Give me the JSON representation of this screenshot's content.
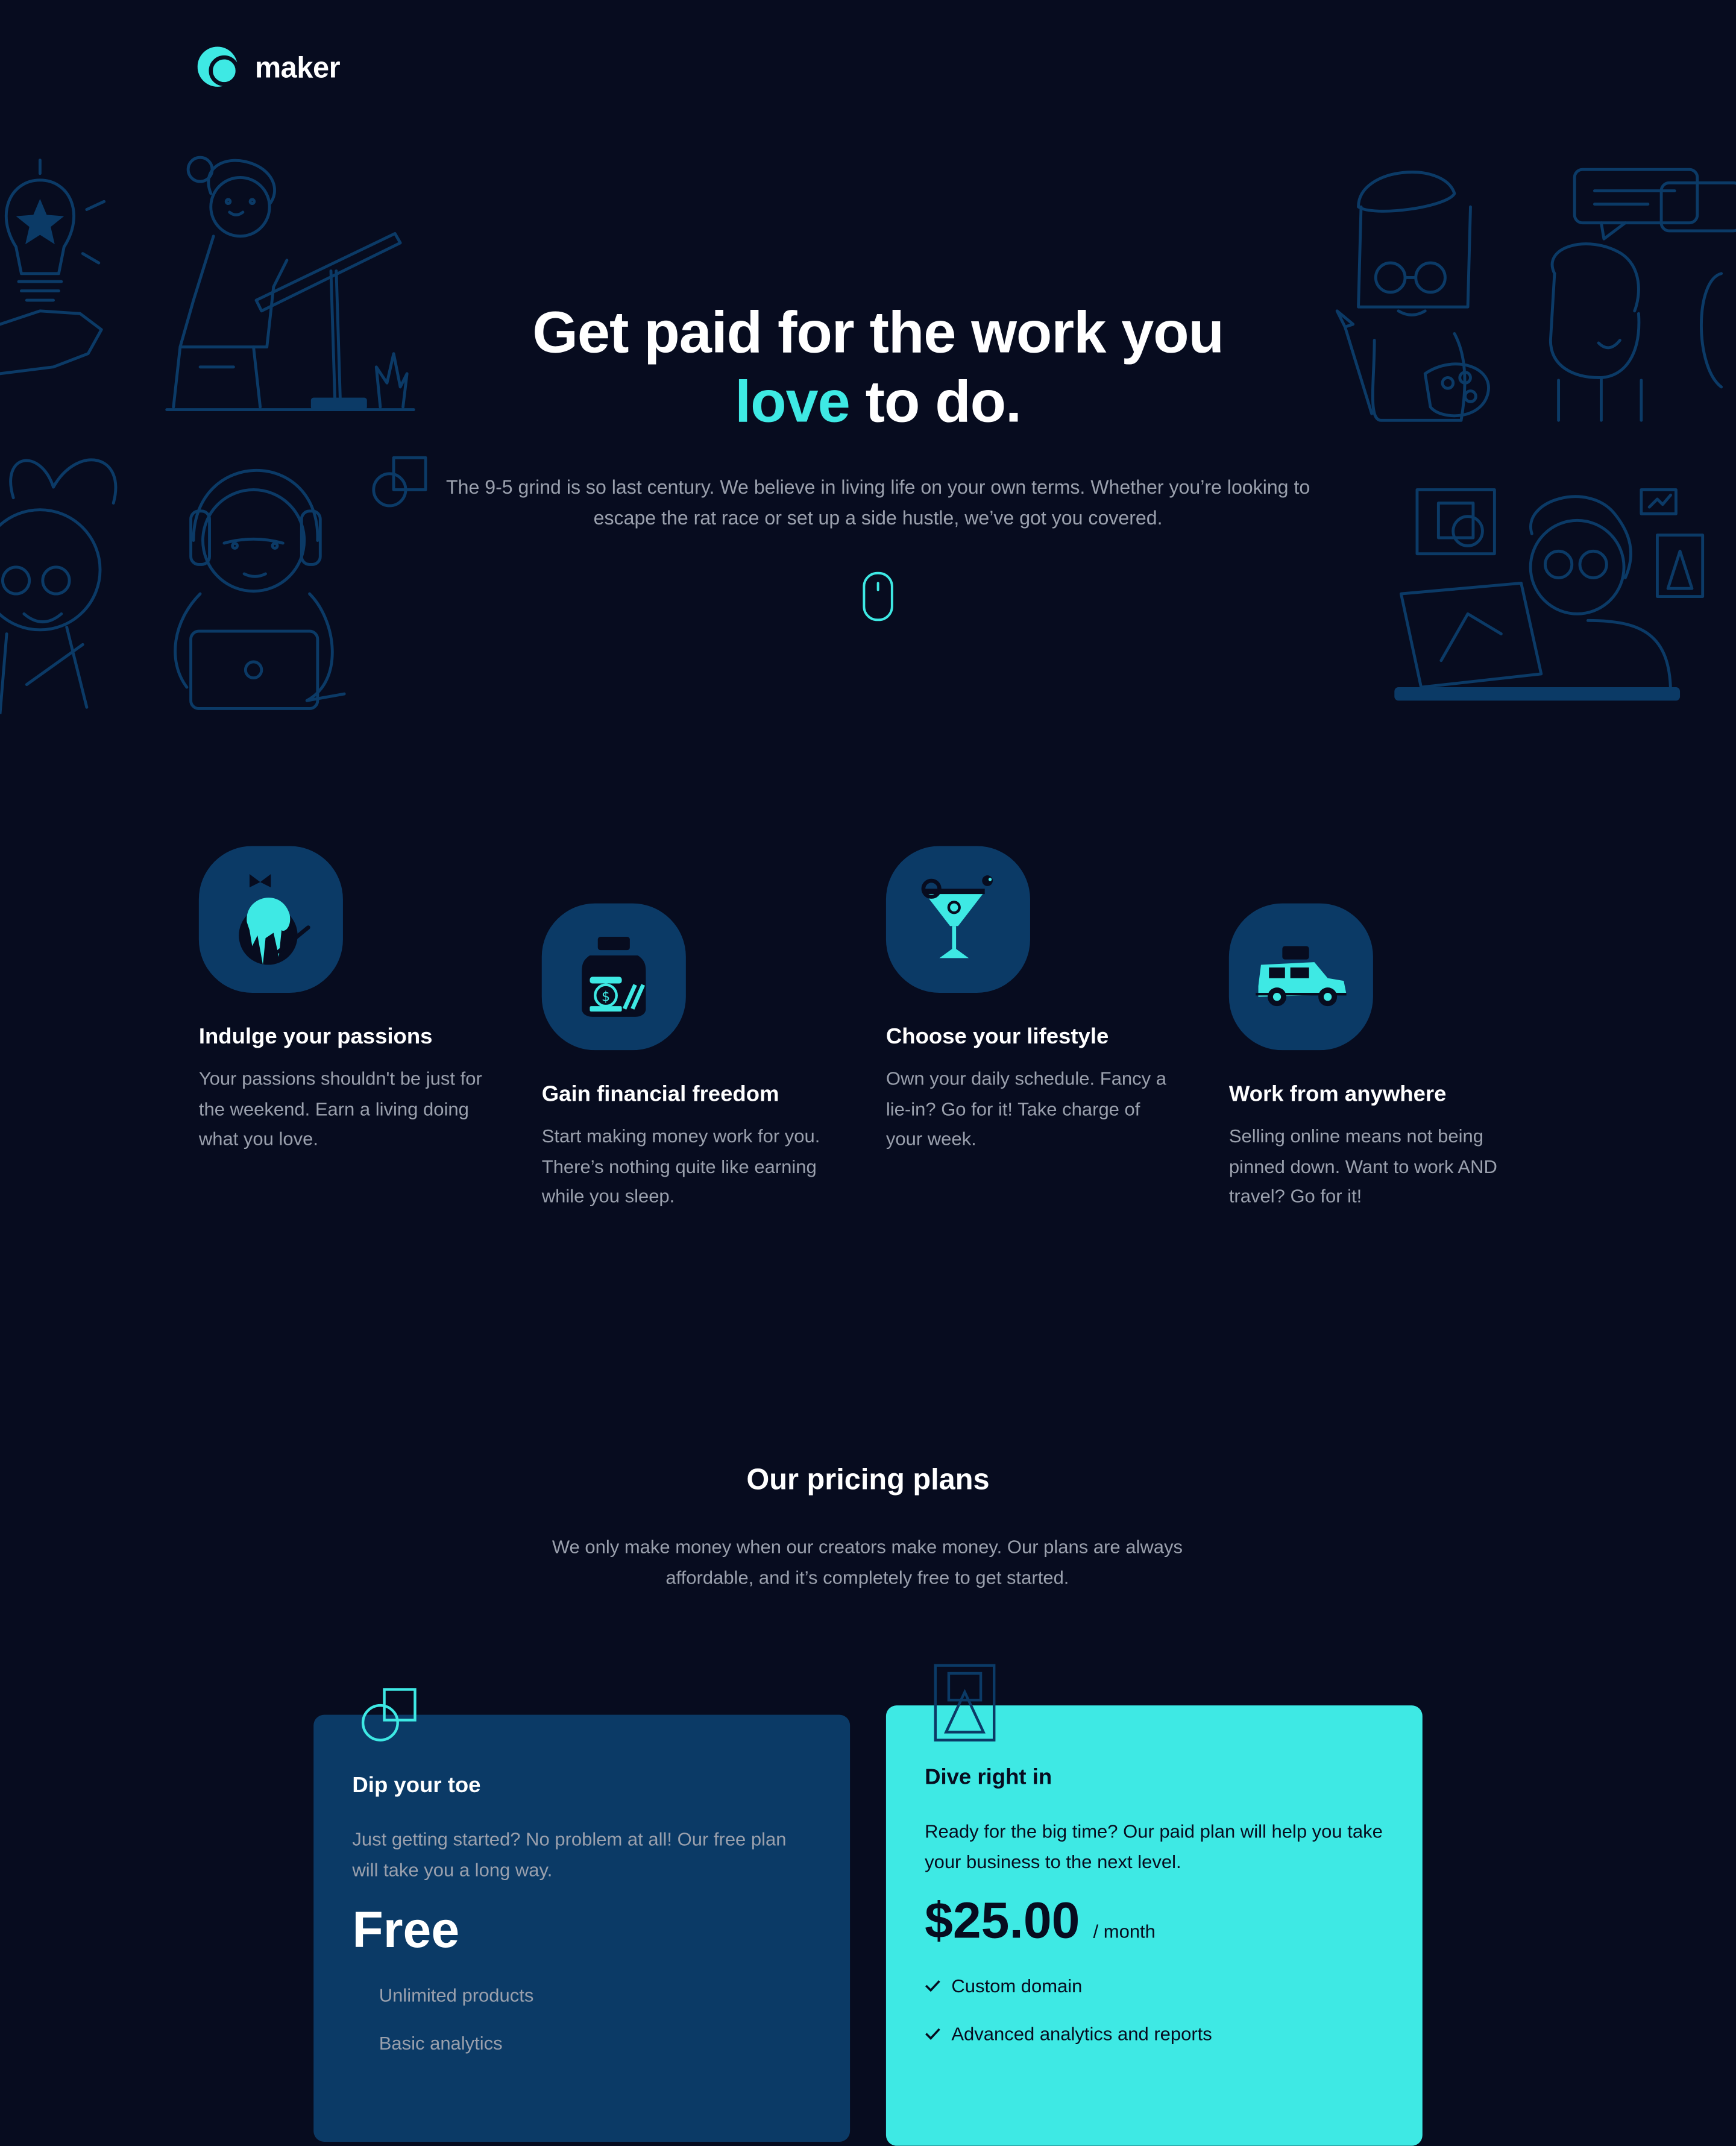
{
  "brand": {
    "name": "maker"
  },
  "hero": {
    "title_line1": "Get paid for the work you",
    "title_accent": "love",
    "title_rest": " to do.",
    "subtitle": "The 9-5 grind is so last century. We believe in living life on your own terms. Whether you’re looking to escape the rat race or set up a side hustle, we’ve got you covered."
  },
  "features": [
    {
      "title": "Indulge your passions",
      "text": "Your passions shouldn't be just for the weekend. Earn a living doing what you love.",
      "icon": "paint-brush-icon"
    },
    {
      "title": "Gain financial freedom",
      "text": "Start making money work for you. There’s nothing quite like earning while you sleep.",
      "icon": "money-jar-icon"
    },
    {
      "title": "Choose your lifestyle",
      "text": "Own your daily schedule. Fancy a lie-in? Go for it! Take charge of your week.",
      "icon": "cocktail-icon"
    },
    {
      "title": "Work from anywhere",
      "text": "Selling online means not being pinned down. Want to work AND travel? Go for it!",
      "icon": "car-icon"
    }
  ],
  "pricing": {
    "title": "Our pricing plans",
    "subtitle": "We only make money when our creators make money. Our plans are always affordable, and it’s completely free to get started.",
    "plans": [
      {
        "name": "Dip your toe",
        "description": "Just getting started? No problem at all! Our free plan will take you a long way.",
        "price": "Free",
        "features": [
          "Unlimited products",
          "Basic analytics"
        ]
      },
      {
        "name": "Dive right in",
        "description": "Ready for the big time? Our paid plan will help you take your business to the next level.",
        "price": "$25.00",
        "period": "/ month",
        "features": [
          "Custom domain",
          "Advanced analytics and reports"
        ]
      }
    ]
  },
  "colors": {
    "background": "#070c1f",
    "accent": "#3ee9e4",
    "deep_blue": "#0b3a66",
    "muted_text": "#9aa0ad"
  }
}
